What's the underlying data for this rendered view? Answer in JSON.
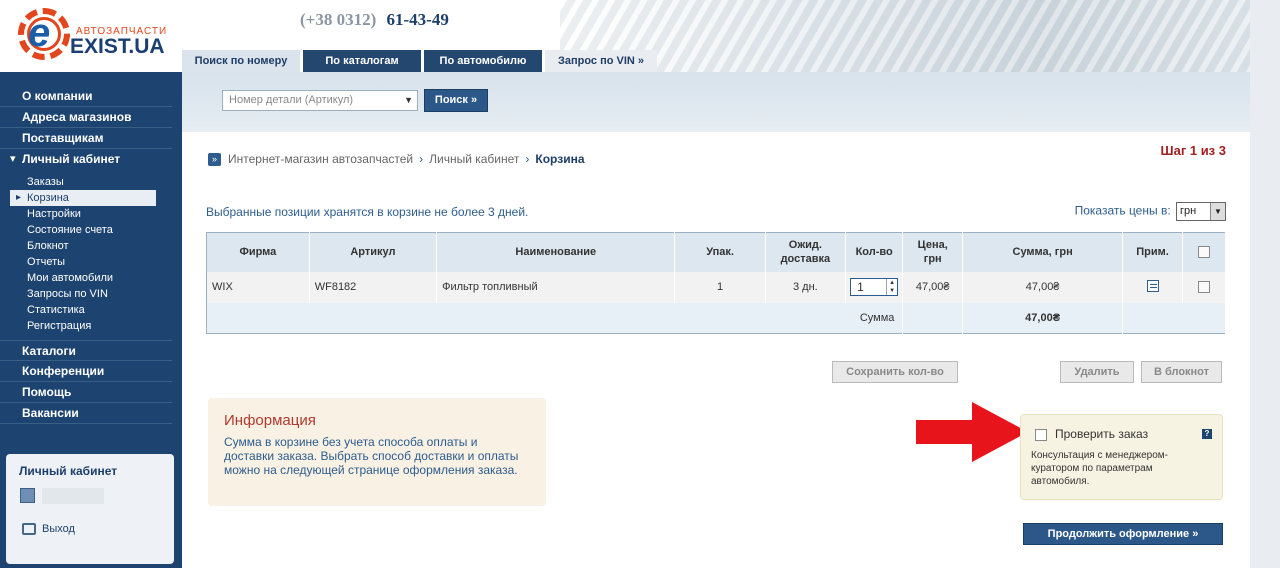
{
  "logo": {
    "sub": "АВТОЗАПЧАСТИ",
    "name": "EXIST.UA",
    "letter": "e"
  },
  "header": {
    "phone_code": "(+38 0312)",
    "phone_number": "61-43-49"
  },
  "tabs": [
    {
      "label": "Поиск по номеру"
    },
    {
      "label": "По каталогам"
    },
    {
      "label": "По автомобилю"
    },
    {
      "label": "Запрос по VIN »"
    }
  ],
  "sidebar": {
    "main_top": [
      {
        "label": "О компании"
      },
      {
        "label": "Адреса магазинов"
      },
      {
        "label": "Поставщикам"
      },
      {
        "label": "Личный кабинет"
      }
    ],
    "sub": [
      {
        "label": "Заказы"
      },
      {
        "label": "Корзина"
      },
      {
        "label": "Настройки"
      },
      {
        "label": "Состояние счета"
      },
      {
        "label": "Блокнот"
      },
      {
        "label": "Отчеты"
      },
      {
        "label": "Мои автомобили"
      },
      {
        "label": "Запросы по VIN"
      },
      {
        "label": "Статистика"
      },
      {
        "label": "Регистрация"
      }
    ],
    "main_bottom": [
      {
        "label": "Каталоги"
      },
      {
        "label": "Конференции"
      },
      {
        "label": "Помощь"
      },
      {
        "label": "Вакансии"
      }
    ],
    "cabinet": {
      "title": "Личный кабинет",
      "exit": "Выход"
    }
  },
  "search": {
    "placeholder": "Номер детали (Артикул)",
    "button": "Поиск »"
  },
  "breadcrumb": {
    "items": [
      "Интернет-магазин автозапчастей",
      "Личный кабинет",
      "Корзина"
    ],
    "sep": "›"
  },
  "step": "Шаг 1 из 3",
  "cart_note": "Выбранные позиции хранятся в корзине не более 3 дней.",
  "price_control": {
    "label": "Показать цены в:",
    "value": "грн"
  },
  "cart": {
    "headers": [
      "Фирма",
      "Артикул",
      "Наименование",
      "Упак.",
      "Ожид.\nдоставка",
      "Кол-во",
      "Цена,\nгрн",
      "Сумма, грн",
      "Прим."
    ],
    "rows": [
      {
        "firm": "WIX",
        "article": "WF8182",
        "name": "Фильтр топливный",
        "pack": "1",
        "delivery": "3 дн.",
        "qty": "1",
        "price": "47,00₴",
        "sum": "47,00₴"
      }
    ],
    "total_label": "Сумма",
    "total_value": "47,00₴"
  },
  "buttons": {
    "save_qty": "Сохранить кол-во",
    "delete": "Удалить",
    "to_notepad": "В блокнот",
    "continue": "Продолжить оформление »"
  },
  "info": {
    "title": "Информация",
    "text": "Сумма в корзине без учета способа оплаты и доставки заказа. Выбрать способ доставки и оплаты можно на следующей странице оформления заказа."
  },
  "check_order": {
    "label": "Проверить заказ",
    "help": "?",
    "desc": "Консультация с менеджером-куратором по параметрам автомобиля."
  },
  "colors": {
    "nav": "#1d4470",
    "button": "#2b5888",
    "step": "#a02020",
    "arrow": "#e8141b"
  },
  "icons": {
    "bc": "double-chevron-icon",
    "note": "edit-note-icon",
    "exit": "exit-icon",
    "user": "user-icon"
  }
}
